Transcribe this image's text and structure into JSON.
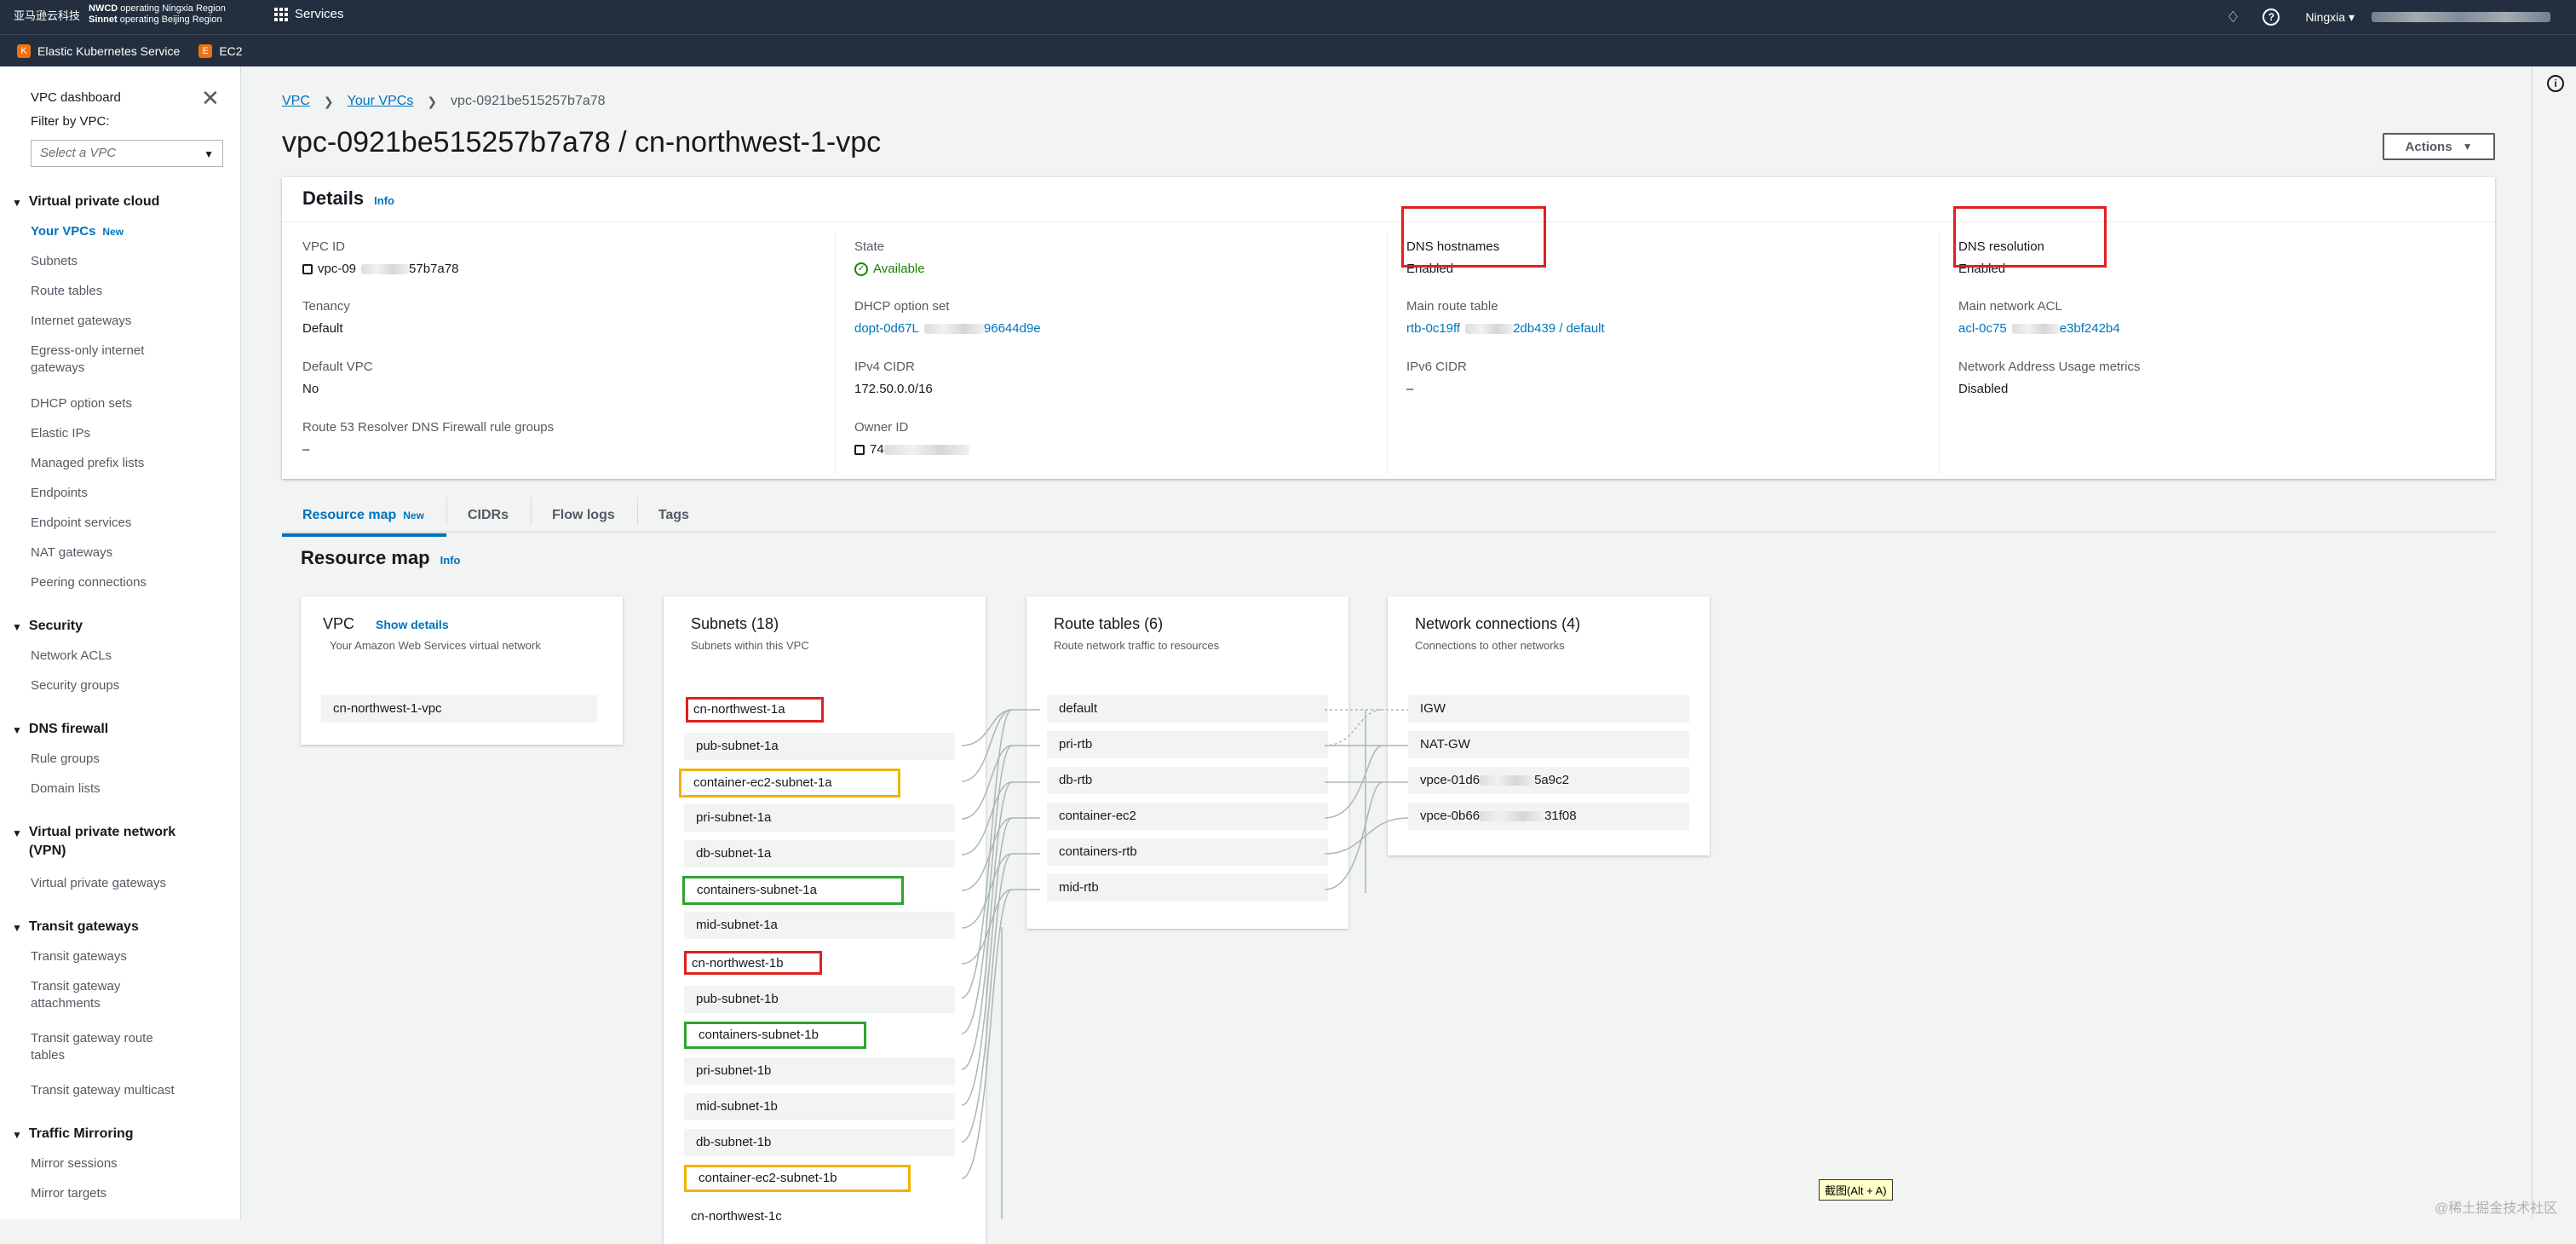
{
  "topnav": {
    "brand_logo": "亚马逊云科技",
    "brand_line1_bold": "NWCD",
    "brand_line1": "operating Ningxia Region",
    "brand_line2_bold": "Sinnet",
    "brand_line2": "operating Beijing Region",
    "services_label": "Services",
    "region_label": "Ningxia ▾",
    "icons": [
      "bell-icon",
      "help-icon"
    ]
  },
  "favorites": [
    {
      "label": "Elastic Kubernetes Service",
      "icon": "eks-icon"
    },
    {
      "label": "EC2",
      "icon": "ec2-icon"
    }
  ],
  "sidebar": {
    "dashboard": "VPC dashboard",
    "filter_label": "Filter by VPC:",
    "filter_placeholder": "Select a VPC",
    "sections": [
      {
        "title": "Virtual private cloud",
        "items": [
          "Your VPCs",
          "Subnets",
          "Route tables",
          "Internet gateways",
          "Egress-only internet gateways",
          "DHCP option sets",
          "Elastic IPs",
          "Managed prefix lists",
          "Endpoints",
          "Endpoint services",
          "NAT gateways",
          "Peering connections"
        ]
      },
      {
        "title": "Security",
        "items": [
          "Network ACLs",
          "Security groups"
        ]
      },
      {
        "title": "DNS firewall",
        "items": [
          "Rule groups",
          "Domain lists"
        ]
      },
      {
        "title": "Virtual private network (VPN)",
        "items": [
          "Virtual private gateways"
        ]
      },
      {
        "title": "Transit gateways",
        "items": [
          "Transit gateways",
          "Transit gateway attachments",
          "Transit gateway route tables",
          "Transit gateway multicast"
        ]
      },
      {
        "title": "Traffic Mirroring",
        "items": [
          "Mirror sessions",
          "Mirror targets"
        ]
      }
    ],
    "new_badge": "New"
  },
  "breadcrumb": {
    "root": "VPC",
    "parent": "Your VPCs",
    "current": "vpc-0921be515257b7a78"
  },
  "page_title": "vpc-0921be515257b7a78 / cn-northwest-1-vpc",
  "actions_label": "Actions",
  "details": {
    "title": "Details",
    "info": "Info",
    "vpc_id_label": "VPC ID",
    "vpc_id_a": "vpc-09",
    "vpc_id_b": "57b7a78",
    "state_label": "State",
    "state_value": "Available",
    "dns_hostnames_label": "DNS hostnames",
    "dns_hostnames_value": "Enabled",
    "dns_resolution_label": "DNS resolution",
    "dns_resolution_value": "Enabled",
    "tenancy_label": "Tenancy",
    "tenancy_value": "Default",
    "dhcp_label": "DHCP option set",
    "dhcp_a": "dopt-0d67L",
    "dhcp_b": "96644d9e",
    "main_rt_label": "Main route table",
    "main_rt_a": "rtb-0c19ff",
    "main_rt_b": "2db439 / default",
    "main_acl_label": "Main network ACL",
    "main_acl_a": "acl-0c75",
    "main_acl_b": "e3bf242b4",
    "default_vpc_label": "Default VPC",
    "default_vpc_value": "No",
    "ipv4_label": "IPv4 CIDR",
    "ipv4_value": "172.50.0.0/16",
    "ipv6_label": "IPv6 CIDR",
    "ipv6_value": "–",
    "nau_label": "Network Address Usage metrics",
    "nau_value": "Disabled",
    "r53_label": "Route 53 Resolver DNS Firewall rule groups",
    "r53_value": "–",
    "owner_label": "Owner ID",
    "owner_value": "74"
  },
  "tabs": [
    {
      "label": "Resource map",
      "badge": "New"
    },
    {
      "label": "CIDRs"
    },
    {
      "label": "Flow logs"
    },
    {
      "label": "Tags"
    }
  ],
  "resource_map": {
    "title": "Resource map",
    "info": "Info",
    "vpc": {
      "title": "VPC",
      "show_details": "Show details",
      "subtitle": "Your Amazon Web Services virtual network",
      "item": "cn-northwest-1-vpc"
    },
    "subnets": {
      "title": "Subnets (18)",
      "subtitle": "Subnets within this VPC",
      "group_a": "cn-northwest-1a",
      "items_a": [
        "pub-subnet-1a",
        "container-ec2-subnet-1a",
        "pri-subnet-1a",
        "db-subnet-1a",
        "containers-subnet-1a",
        "mid-subnet-1a"
      ],
      "group_b": "cn-northwest-1b",
      "items_b": [
        "pub-subnet-1b",
        "containers-subnet-1b",
        "pri-subnet-1b",
        "mid-subnet-1b",
        "db-subnet-1b",
        "container-ec2-subnet-1b"
      ],
      "group_c": "cn-northwest-1c"
    },
    "route_tables": {
      "title": "Route tables (6)",
      "subtitle": "Route network traffic to resources",
      "items": [
        "default",
        "pri-rtb",
        "db-rtb",
        "container-ec2",
        "containers-rtb",
        "mid-rtb"
      ]
    },
    "connections": {
      "title": "Network connections (4)",
      "subtitle": "Connections to other networks",
      "items": [
        "IGW",
        "NAT-GW"
      ],
      "vpce1_a": "vpce-01d6",
      "vpce1_b": "5a9c2",
      "vpce2_a": "vpce-0b66",
      "vpce2_b": "31f08"
    }
  },
  "tooltip": "截图(Alt + A)",
  "watermark": "@稀土掘金技术社区"
}
